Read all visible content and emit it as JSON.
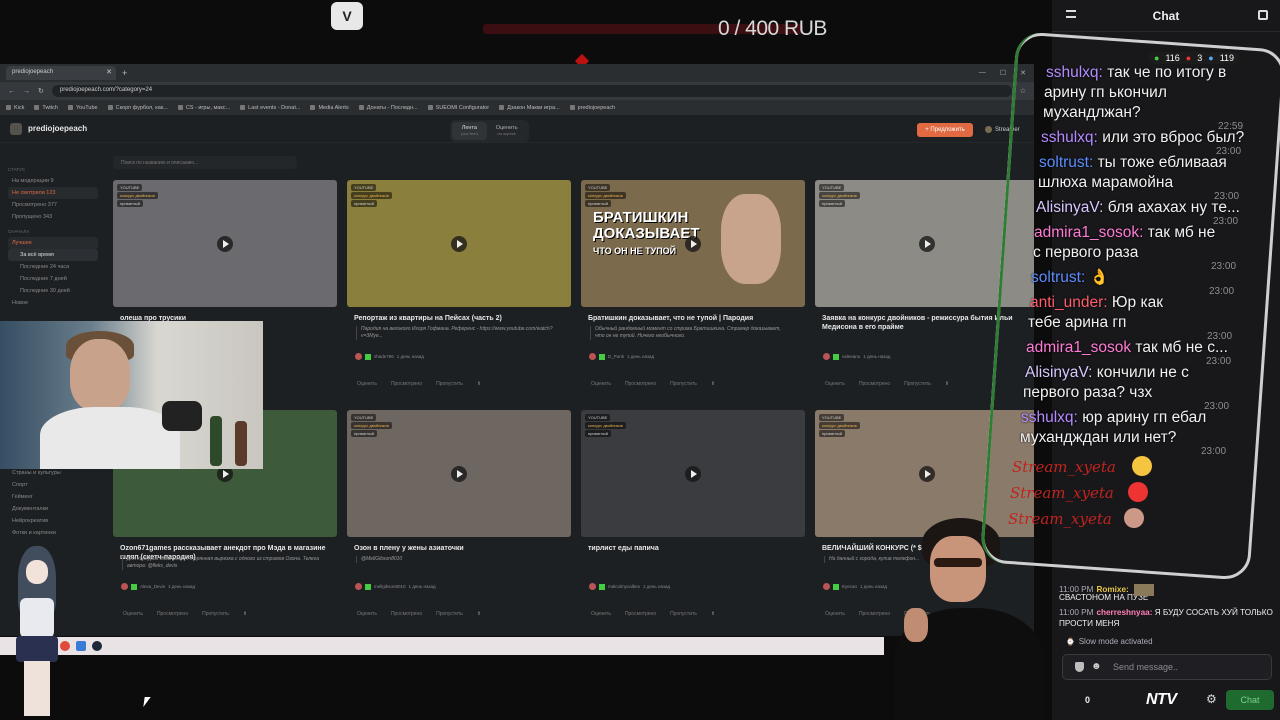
{
  "overlay": {
    "logo": "V",
    "goal_text": "0 / 400 RUB"
  },
  "browser": {
    "tab_title": "prediojoepeach",
    "url": "prediojoepeach.com/?category=24",
    "bookmarks": [
      "Kick",
      "Twitch",
      "YouTube",
      "Скорп фурбол, как...",
      "CS - игры, макс...",
      "Last events - Donat...",
      "Media Alerts",
      "Донаты - Последн...",
      "SUEOMI Configurator",
      "Дзакон Макки игра...",
      "prediojoepeach"
    ],
    "site": {
      "brand": "prediojoepeach",
      "tabs": [
        {
          "label": "Лента",
          "sub": "your feed"
        },
        {
          "label": "Оценить",
          "sub": "на оценке"
        }
      ],
      "propose_button": "+ Предложить",
      "user": "Streamer",
      "search_placeholder": "Поиск по названию и описанию...",
      "sidebar": {
        "status_heading": "Статус",
        "status_items": [
          "На модерации 9",
          "Не смотрели 123",
          "Просмотрено 377",
          "Пропущено 343"
        ],
        "sort_heading": "Сначала",
        "sort_items": [
          "Лучшее",
          "За всё время",
          "Последние 24 часа",
          "Последние 7 дней",
          "Последние 30 дней",
          "Новое"
        ],
        "categories": [
          "Страны и культуры",
          "Спорт",
          "Гейминг",
          "Документалки",
          "Нейрокреатив",
          "Фотки и картинки"
        ]
      }
    },
    "cards": [
      {
        "title": "олеша про трусики",
        "desc": "",
        "author": "",
        "ago": "",
        "tag": "YOUTUBE",
        "thumb": "#6b6a6e"
      },
      {
        "title": "Репортаж из квартиры на Пейсах (часть 2)",
        "desc": "Пародия на великого Игоря Гофмана. Референс - https://www.youtube.com/watch?v=3Mye...",
        "author": "shade786",
        "ago": "1 день назад",
        "tag": "YOUTUBE",
        "thumb": "#8a7f3d"
      },
      {
        "title": "Братишкин доказывает, что не тупой | Пародия",
        "desc": "Обычный рандомный момент со стрима Братишкина. Стример доказывает, что он не тупой. Ничего необычного.",
        "author": "D_Punk",
        "ago": "1 день назад",
        "tag": "YOUTUBE",
        "thumb": "#7c6a4c"
      },
      {
        "title": "Заявка на конкурс двойников - режиссура бытия Ильи Медисона в его прайме",
        "desc": "",
        "author": "valeeanu",
        "ago": "1 день назад",
        "tag": "YOUTUBE",
        "thumb": "#8d8b85"
      },
      {
        "title": "Ozon671games рассказывает анекдот про Мэда в магазине шляп (скетч-пародия)",
        "desc": "Для конкурса двойников. Утерянная вырезка с одного из стримов Озона. Телега автора: @fleks_devis",
        "author": "Alexa_Devis",
        "ago": "1 день назад",
        "tag": "YOUTUBE",
        "thumb": "#3d5a3a"
      },
      {
        "title": "Озон в плену у жены азиаточки",
        "desc": "@MellGibson8010",
        "author": "mellgibson8010",
        "ago": "1 день назад",
        "tag": "YOUTUBE",
        "thumb": "#6e6660"
      },
      {
        "title": "тирлист еды папича",
        "desc": "",
        "author": "malcolmycalbex",
        "ago": "1 день назад",
        "tag": "YOUTUBE",
        "thumb": "#3a3c40"
      },
      {
        "title": "ВЕЛИЧАЙШИЙ КОНКУРС (* $ ...",
        "desc": "На данный с города, купив телефон...",
        "author": "Eyecan",
        "ago": "1 день назад",
        "tag": "YOUTUBE",
        "thumb": "#8a7a6a"
      }
    ],
    "card_tag2": "конкурс двойников",
    "card_tag3": "приватный",
    "card_actions": [
      "Оценить",
      "Просмотрено",
      "Пропустить"
    ]
  },
  "brat_text": {
    "line1": "БРАТИШКИН",
    "line2": "ДОКАЗЫВАЕТ",
    "line3": "ЧТО ОН НЕ ТУПОЙ"
  },
  "chat": {
    "title": "Chat",
    "messages": [
      {
        "time": "",
        "user": "",
        "text": "СВАСТОНОМ НА ПУЗЕ",
        "color": "#efeff1"
      },
      {
        "time": "11:00 PM",
        "user": "Romixe:",
        "text": "",
        "color": "#e8c547"
      },
      {
        "time": "11:00 PM",
        "user": "cherreshnyaa:",
        "text": "Я БУДУ СОСАТЬ ХУЙ ТОЛЬКО ПРОСТИ МЕНЯ",
        "color": "#ff7eb6"
      }
    ],
    "slow_mode": "Slow mode activated",
    "placeholder": "Send message..",
    "count": "0",
    "brand": "NTV",
    "button": "Chat"
  },
  "phone": {
    "stats": [
      "116",
      "3",
      "119"
    ],
    "messages": [
      {
        "user": "sshulxq:",
        "text": "так че по итогу в",
        "time": "",
        "color": "#b58cff"
      },
      {
        "user": "",
        "text": "арину гп ькончил",
        "time": "",
        "color": "#f1f1f1"
      },
      {
        "user": "",
        "text": "мухандлжан?",
        "time": "22:59",
        "color": "#f1f1f1"
      },
      {
        "user": "sshulxq:",
        "text": "или это вброс был?",
        "time": "23:00",
        "color": "#b58cff"
      },
      {
        "user": "soltrust:",
        "text": "ты тоже ебливаая",
        "time": "",
        "color": "#5b8dff"
      },
      {
        "user": "",
        "text": "шлюха марамойна",
        "time": "23:00",
        "color": "#f1f1f1"
      },
      {
        "user": "AlisinyaV:",
        "text": "бля ахахах ну те...",
        "time": "23:00",
        "color": "#d8c8ff"
      },
      {
        "user": "admira1_sosok:",
        "text": "так мб не",
        "time": "",
        "color": "#ff7bd5"
      },
      {
        "user": "",
        "text": "с первого раза",
        "time": "23:00",
        "color": "#f1f1f1"
      },
      {
        "user": "soltrust:",
        "text": "👌",
        "time": "23:00",
        "color": "#5b8dff"
      },
      {
        "user": "anti_under:",
        "text": "Юр как",
        "time": "",
        "color": "#ff5d6a"
      },
      {
        "user": "",
        "text": "тебе арина гп",
        "time": "23:00",
        "color": "#f1f1f1"
      },
      {
        "user": "admira1_sosok",
        "text": "так мб не с...",
        "time": "23:00",
        "color": "#ff7bd5"
      },
      {
        "user": "AlisinyaV:",
        "text": "кончили не с",
        "time": "",
        "color": "#d8c8ff"
      },
      {
        "user": "",
        "text": "первого раза? чзх",
        "time": "23:00",
        "color": "#f1f1f1"
      },
      {
        "user": "sshulxq:",
        "text": "юр арину гп ебал",
        "time": "",
        "color": "#b58cff"
      },
      {
        "user": "",
        "text": "мухандждан или нет?",
        "time": "23:00",
        "color": "#f1f1f1"
      }
    ],
    "stream_user": "Stream_xyeta"
  }
}
